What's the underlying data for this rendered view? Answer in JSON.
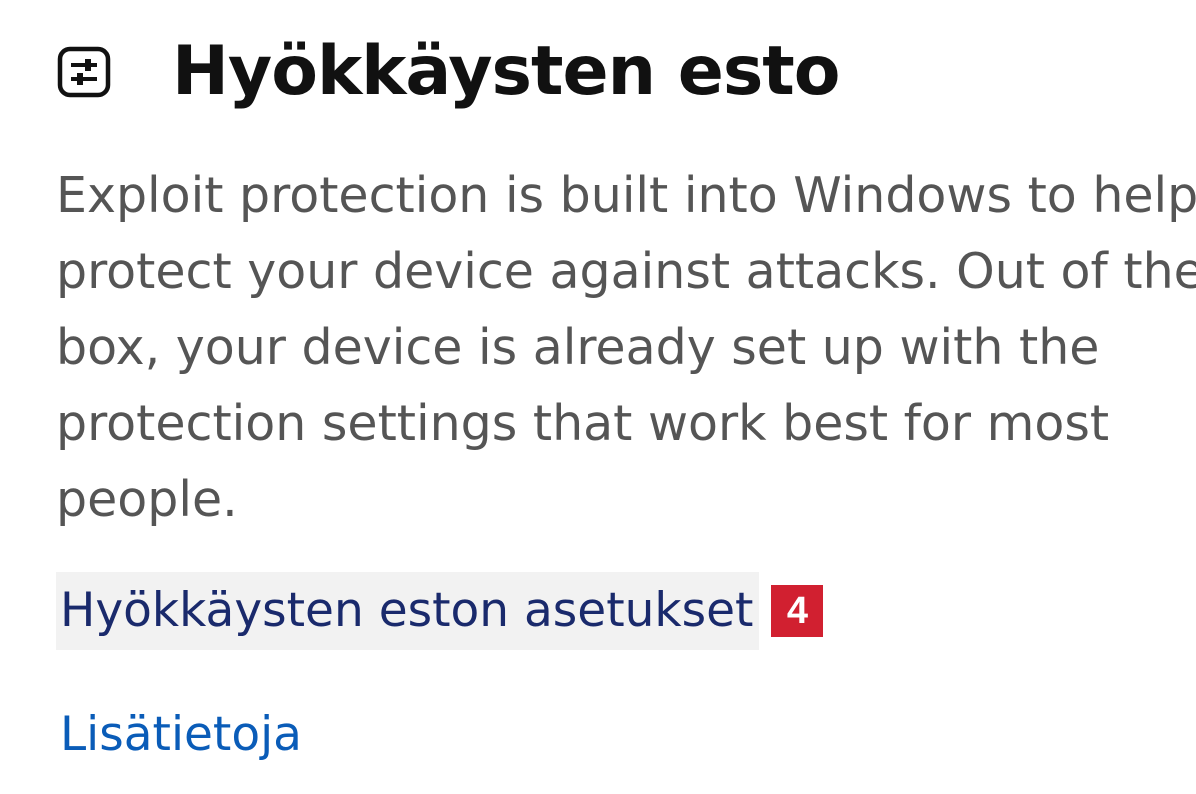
{
  "section": {
    "icon": "exploit-protection-sliders-icon",
    "title": "Hyökkäysten esto",
    "description": "Exploit protection is built into Windows to help protect your device against attacks. Out of the box, your device is already set up with the protection settings that work best for most people."
  },
  "links": {
    "settings_label": "Hyökkäysten eston asetukset",
    "more_info_label": "Lisätietoja"
  },
  "annotation": {
    "step_number": "4",
    "badge_color": "#d12030"
  },
  "colors": {
    "title": "#111111",
    "body_text": "#555555",
    "settings_link": "#1a2a6c",
    "more_info_link": "#0a5cb8",
    "link_highlight": "#f2f2f2"
  }
}
